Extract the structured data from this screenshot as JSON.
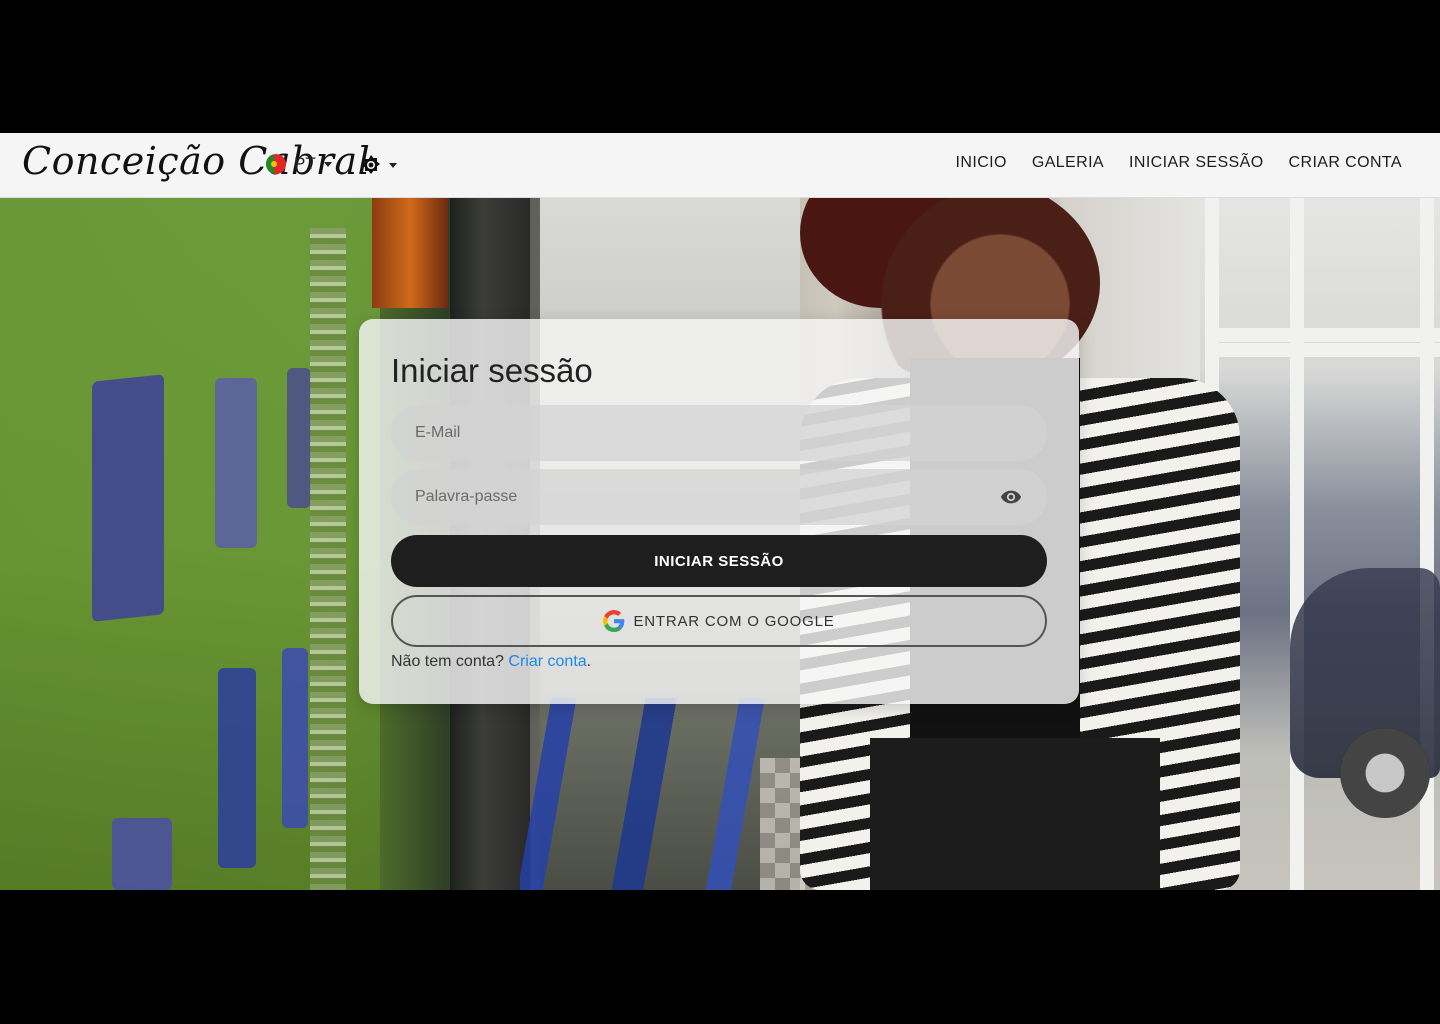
{
  "header": {
    "brand": "Conceição Cabral",
    "language": {
      "code": "PT",
      "flag": "portugal-flag-icon"
    },
    "theme_icon": "brightness-icon",
    "nav": [
      {
        "label": "INICIO"
      },
      {
        "label": "GALERIA"
      },
      {
        "label": "INICIAR SESSÃO"
      },
      {
        "label": "CRIAR CONTA"
      }
    ]
  },
  "login": {
    "title": "Iniciar sessão",
    "email_placeholder": "E-Mail",
    "password_placeholder": "Palavra-passe",
    "submit_label": "INICIAR SESSÃO",
    "google_label": "ENTRAR COM O GOOGLE",
    "signup_prompt": "Não tem conta?",
    "signup_link": "Criar conta",
    "signup_suffix": "."
  },
  "colors": {
    "link": "#1e88e5",
    "primary_button": "#1e1e1e",
    "navbar_bg": "#f5f5f5"
  }
}
